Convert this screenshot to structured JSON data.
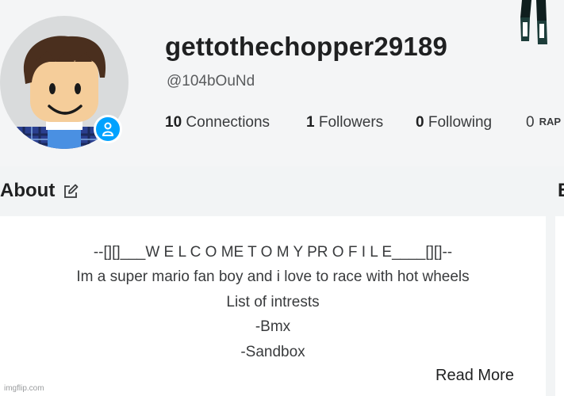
{
  "profile": {
    "username": "gettothechopper29189",
    "handle": "@104bOuNd",
    "status_icon": "person-icon",
    "status_color": "#00a2ff"
  },
  "stats": {
    "connections": {
      "count": "10",
      "label": "Connections"
    },
    "followers": {
      "count": "1",
      "label": "Followers"
    },
    "following": {
      "count": "0",
      "label": "Following"
    },
    "rap": {
      "count": "0",
      "label": "RAP"
    }
  },
  "about": {
    "title": "About",
    "edit_icon": "edit-icon",
    "lines": [
      "--[][]___W E L C O ME T O M Y PR O F I L E____[][]--",
      "Im a super mario fan boy and i love to race with hot wheels",
      "List of intrests",
      "-Bmx",
      "-Sandbox"
    ],
    "read_more": "Read More"
  },
  "right_section": {
    "title_initial": "B"
  },
  "watermark": "imgflip.com"
}
